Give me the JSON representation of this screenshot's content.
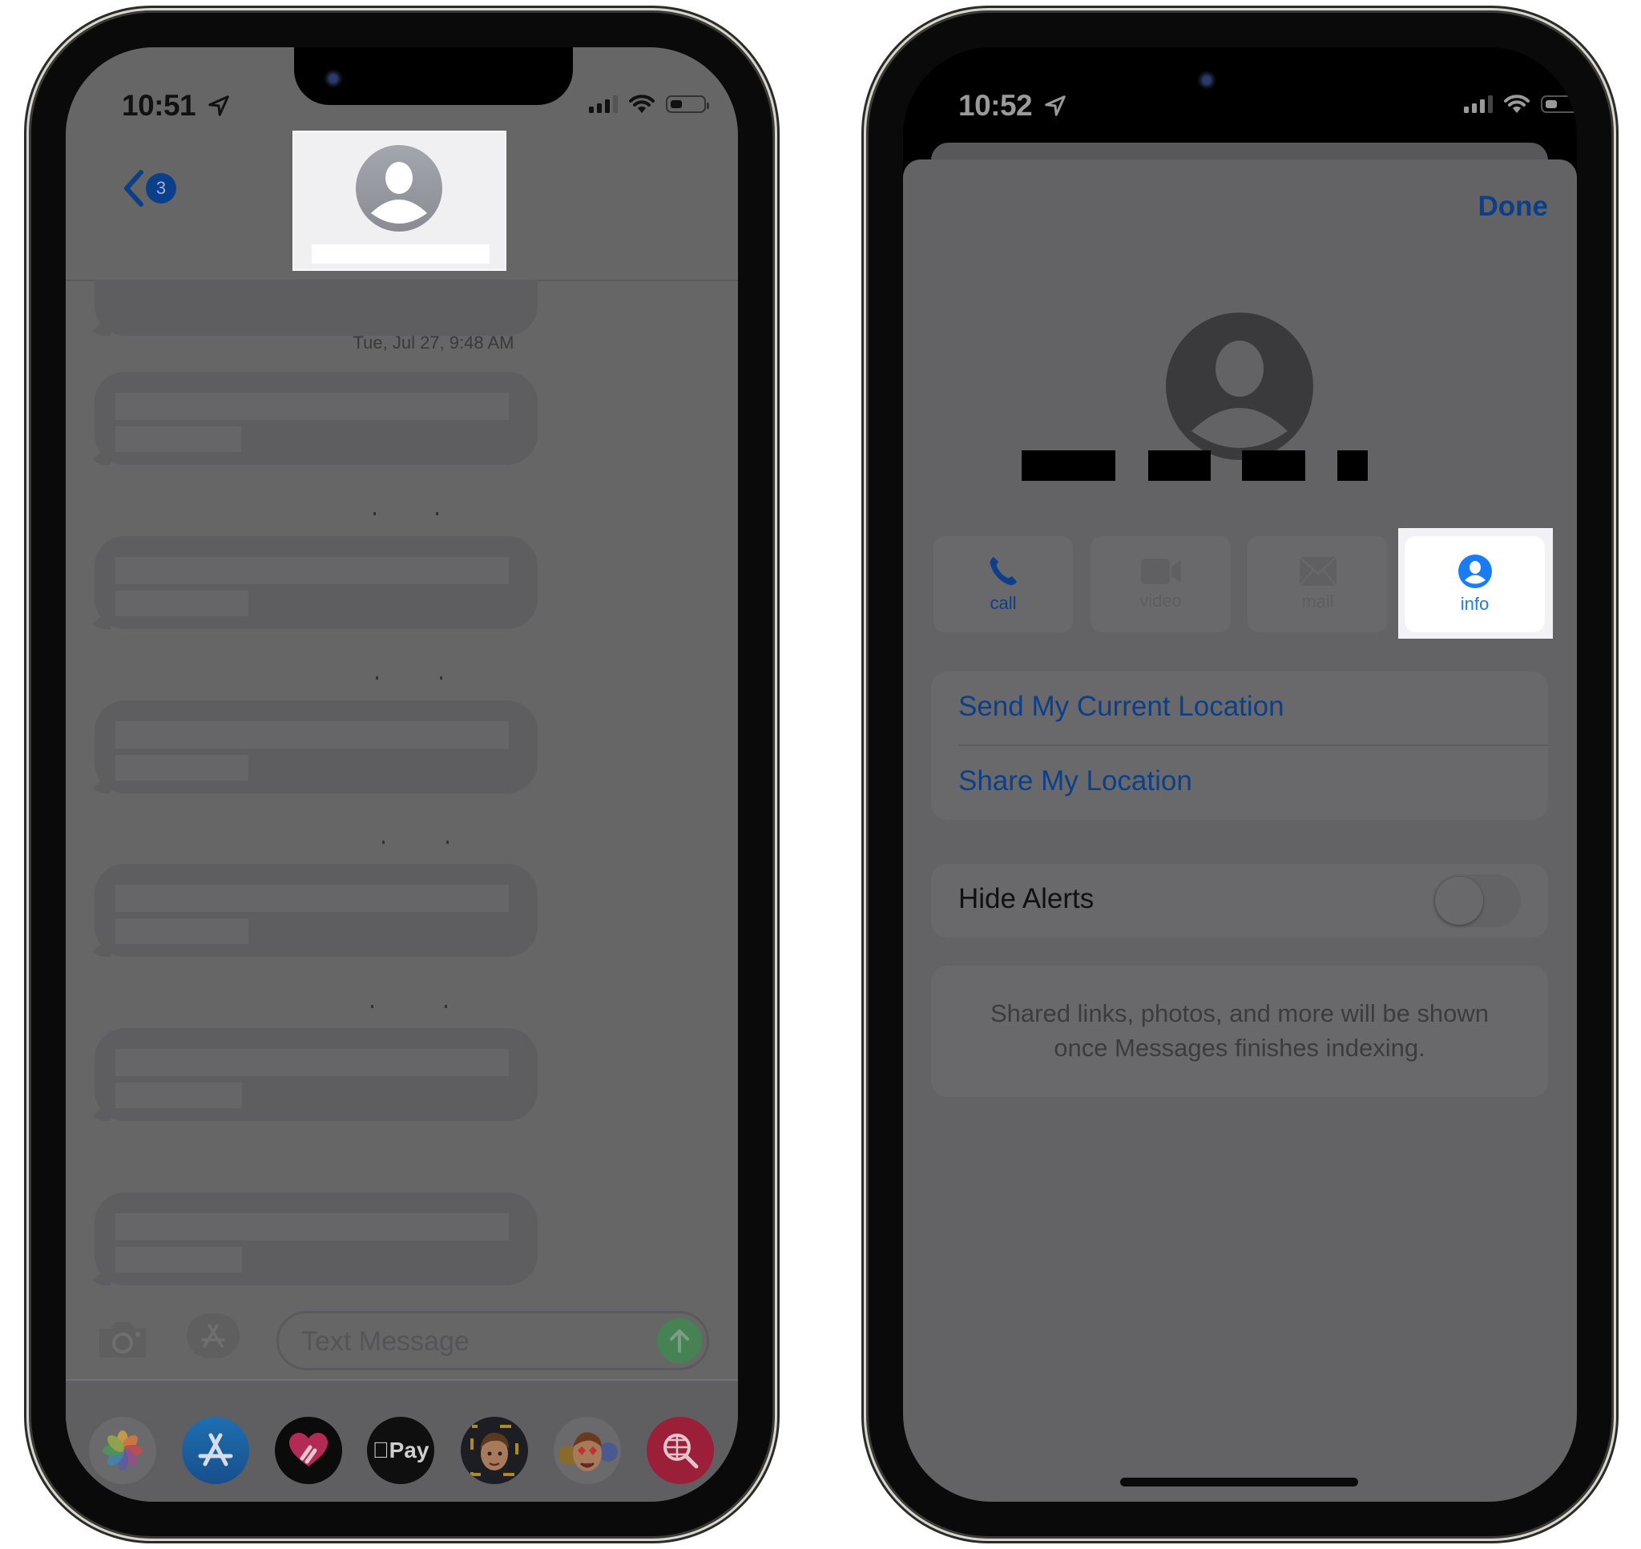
{
  "left_phone": {
    "status_bar": {
      "time": "10:51",
      "location_icon": "location-arrow-icon",
      "signal_icon": "cellular-signal-icon",
      "wifi_icon": "wifi-icon",
      "battery_icon": "battery-icon"
    },
    "header": {
      "back_icon": "chevron-left-icon",
      "unread_badge": "3",
      "contact_avatar_icon": "person-circle-icon",
      "contact_name": ""
    },
    "conversation": {
      "timestamp": "Tue, Jul 27, 9:48 AM",
      "message_count": 6
    },
    "input_bar": {
      "camera_icon": "camera-icon",
      "apps_icon": "app-store-icon",
      "placeholder": "Text Message",
      "value": "",
      "send_icon": "arrow-up-icon"
    },
    "app_drawer": [
      {
        "name": "Photos",
        "icon": "photos-icon"
      },
      {
        "name": "App Store",
        "icon": "app-store-icon"
      },
      {
        "name": "Digital Touch",
        "icon": "digital-touch-icon"
      },
      {
        "name": "Apple Pay",
        "icon": "apple-pay-icon",
        "label": "Pay"
      },
      {
        "name": "Memoji",
        "icon": "memoji-icon"
      },
      {
        "name": "Memoji Stickers",
        "icon": "memoji-stickers-icon"
      },
      {
        "name": "Images Search",
        "icon": "image-search-icon"
      }
    ]
  },
  "right_phone": {
    "status_bar": {
      "time": "10:52",
      "location_icon": "location-arrow-icon",
      "signal_icon": "cellular-signal-icon",
      "wifi_icon": "wifi-icon",
      "battery_icon": "battery-icon"
    },
    "sheet": {
      "done_label": "Done",
      "avatar_icon": "person-circle-icon",
      "actions": [
        {
          "label": "call",
          "icon": "phone-icon",
          "enabled": true
        },
        {
          "label": "video",
          "icon": "video-camera-icon",
          "enabled": false
        },
        {
          "label": "mail",
          "icon": "envelope-icon",
          "enabled": false
        },
        {
          "label": "info",
          "icon": "person-circle-icon",
          "enabled": true,
          "highlighted": true
        }
      ],
      "location_options": [
        "Send My Current Location",
        "Share My Location"
      ],
      "hide_alerts": {
        "label": "Hide Alerts",
        "on": false
      },
      "info_message": "Shared links, photos, and more will be shown once Messages finishes indexing."
    }
  },
  "colors": {
    "accent_blue": "#0c3f8a",
    "info_blue": "#1a7cf5",
    "dimmed_screen": "#666666",
    "sheet_bg": "#636366"
  }
}
